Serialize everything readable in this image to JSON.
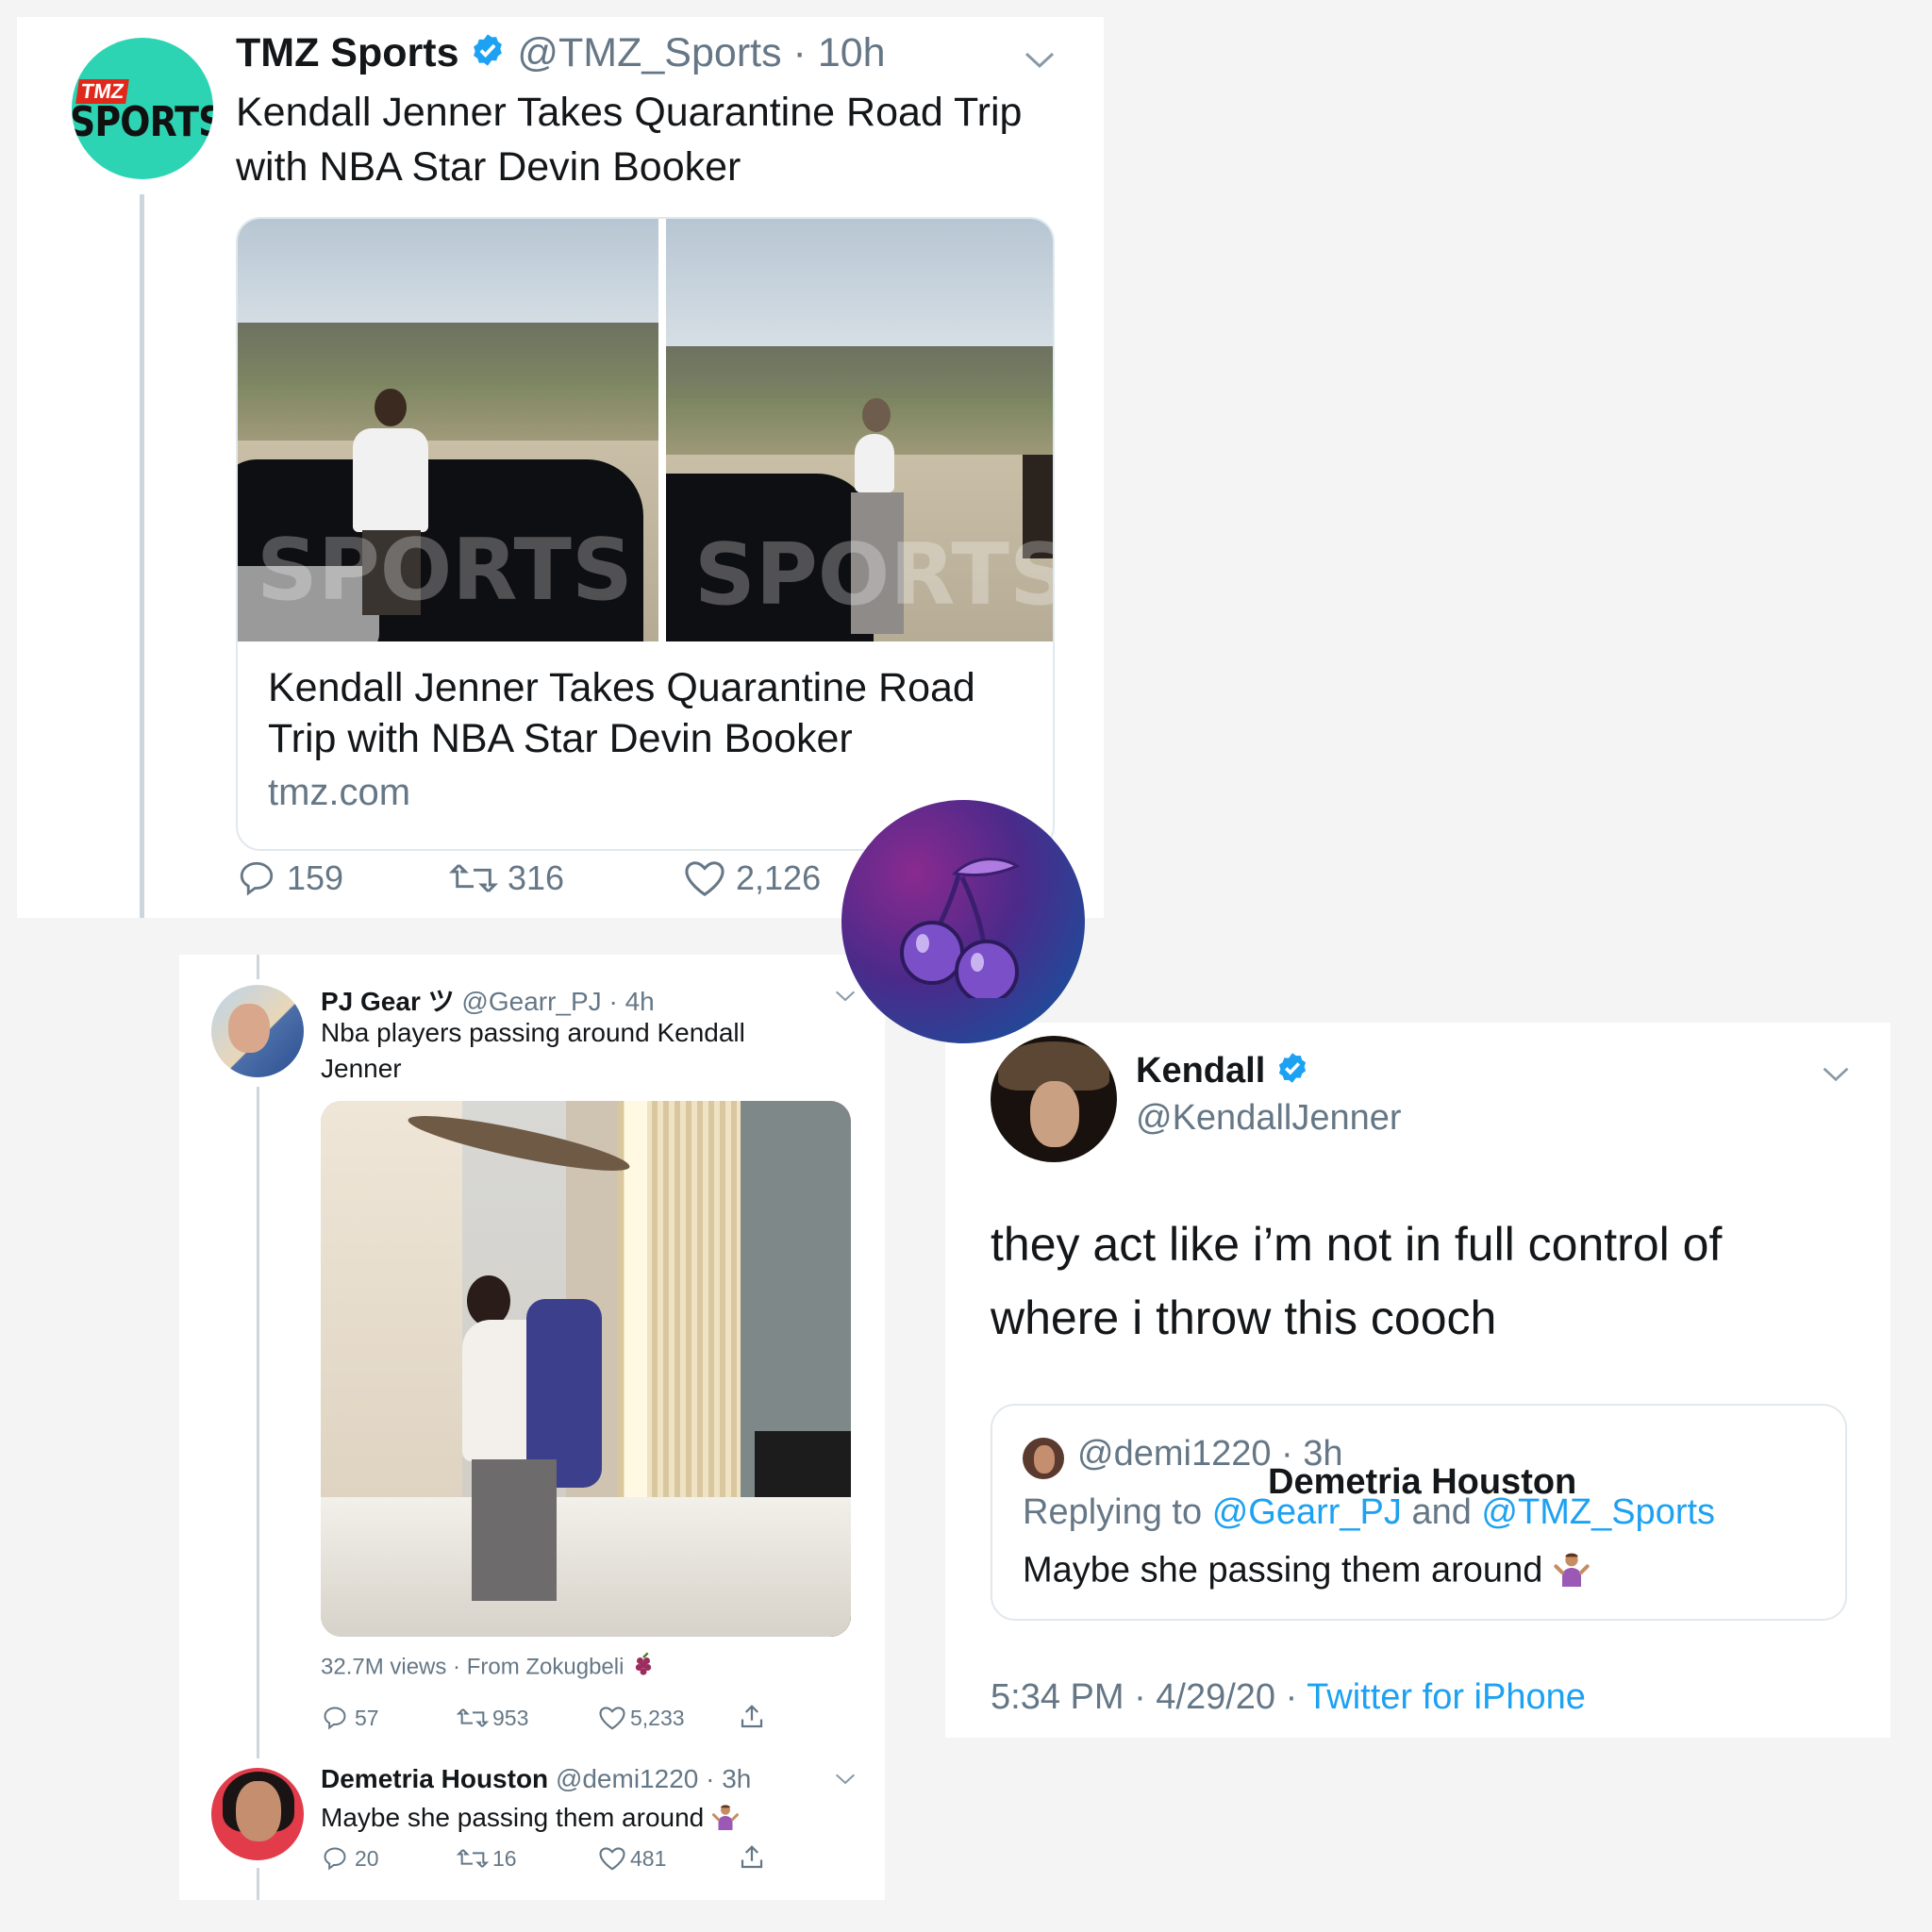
{
  "tmz_tweet": {
    "name": "TMZ Sports",
    "handle": "@TMZ_Sports",
    "separator": "·",
    "time": "10h",
    "text": "Kendall Jenner Takes Quarantine Road Trip with NBA Star Devin Booker",
    "avatar_logo": {
      "small": "TMZ",
      "big": "SPORTS"
    },
    "link_card": {
      "title": "Kendall Jenner Takes Quarantine Road Trip with NBA Star Devin Booker",
      "domain": "tmz.com"
    },
    "replies": "159",
    "retweets": "316",
    "likes": "2,126"
  },
  "pj_tweet": {
    "name": "PJ Gear ツ",
    "handle": "@Gearr_PJ",
    "separator": "·",
    "time": "4h",
    "text": "Nba players passing around Kendall Jenner",
    "views": "32.7M views · From Zokugbeli",
    "replies": "57",
    "retweets": "953",
    "likes": "5,233"
  },
  "demetria_reply": {
    "name": "Demetria Houston",
    "handle": "@demi1220",
    "separator": "·",
    "time": "3h",
    "text": "Maybe she passing them around",
    "replies": "20",
    "retweets": "16",
    "likes": "481"
  },
  "kendall_tweet": {
    "name": "Kendall",
    "handle": "@KendallJenner",
    "text": "they act like i’m not in full control of where i throw this cooch",
    "quote": {
      "name": "Demetria Houston",
      "handle": "@demi1220",
      "separator": "·",
      "time": "3h",
      "replying_label": "Replying to",
      "replying_user1": "@Gearr_PJ",
      "replying_and": "and",
      "replying_user2": "@TMZ_Sports",
      "text": "Maybe she passing them around"
    },
    "timestamp": "5:34 PM · 4/29/20 ·",
    "source": "Twitter for iPhone"
  },
  "colors": {
    "accent_blue": "#1da1f2",
    "muted_text": "#657786",
    "tmz_avatar_bg": "#2dd4b4",
    "badge_gradient_start": "#8a2a8f",
    "badge_gradient_end": "#0b5aa0"
  },
  "icons": {
    "verified": "verified-badge-icon",
    "reply": "reply-bubble-icon",
    "retweet": "retweet-arrows-icon",
    "like": "heart-icon",
    "share": "share-upload-icon",
    "menu": "chevron-down-icon",
    "badge": "cherry-icon",
    "grapes": "grapes-emoji-icon",
    "shrug": "person-shrugging-emoji-icon"
  }
}
